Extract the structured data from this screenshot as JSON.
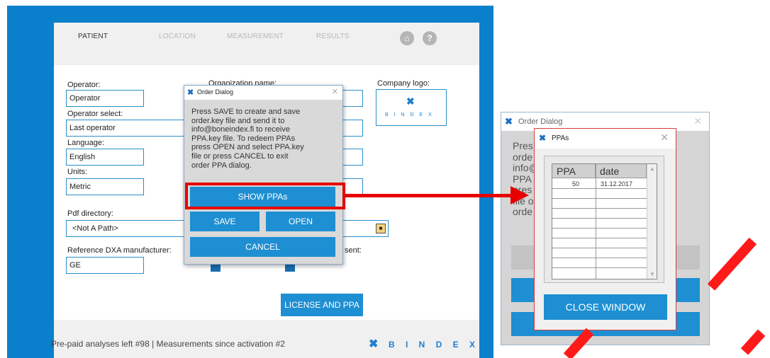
{
  "app": {
    "nav": {
      "tabs": [
        "PATIENT",
        "LOCATION",
        "MEASUREMENT",
        "RESULTS"
      ],
      "active_tab": "PATIENT"
    },
    "fields": {
      "operator_label": "Operator:",
      "operator_value": "Operator",
      "operator_select_label": "Operator select:",
      "operator_select_value": "Last operator",
      "language_label": "Language:",
      "language_value": "English",
      "units_label": "Units:",
      "units_value": "Metric",
      "organization_label": "Organization name:",
      "company_logo_label": "Company logo:",
      "pdf_dir_label": "Pdf directory:",
      "pdf_dir_value": "<Not A Path>",
      "ref_dxa_label": "Reference DXA manufacturer:",
      "ref_dxa_value": "GE",
      "consent_label_partial": "sent:"
    },
    "logo_text": "B I N D E X",
    "license_button": "LICENSE AND PPA",
    "footer_status": "Pre-paid analyses left #98 | Measurements since activation #2",
    "footer_brand": "B I N D E X"
  },
  "order_dialog": {
    "title": "Order Dialog",
    "message_lines": [
      "Press SAVE to create and save",
      "order.key file and send it to",
      "info@boneindex.fi to receive",
      "PPA.key file. To redeem PPAs",
      "press OPEN and select PPA.key",
      "file or press CANCEL to exit",
      "order PPA dialog."
    ],
    "show_ppas": "SHOW PPAs",
    "save": "SAVE",
    "open": "OPEN",
    "cancel": "CANCEL"
  },
  "order_dialog_right": {
    "title": "Order Dialog",
    "partial_lines": [
      "Pres",
      "orde",
      "info@",
      "PPA",
      "pres",
      "file o",
      "orde"
    ]
  },
  "ppa_window": {
    "title": "PPAs",
    "columns": [
      "PPA",
      "date"
    ],
    "rows": [
      {
        "ppa": "50",
        "date": "31.12.2017"
      }
    ],
    "close_button": "CLOSE WINDOW"
  },
  "colors": {
    "app_blue": "#0a80cc",
    "button_blue": "#1e8fd2",
    "annotation_red": "#e60000"
  }
}
